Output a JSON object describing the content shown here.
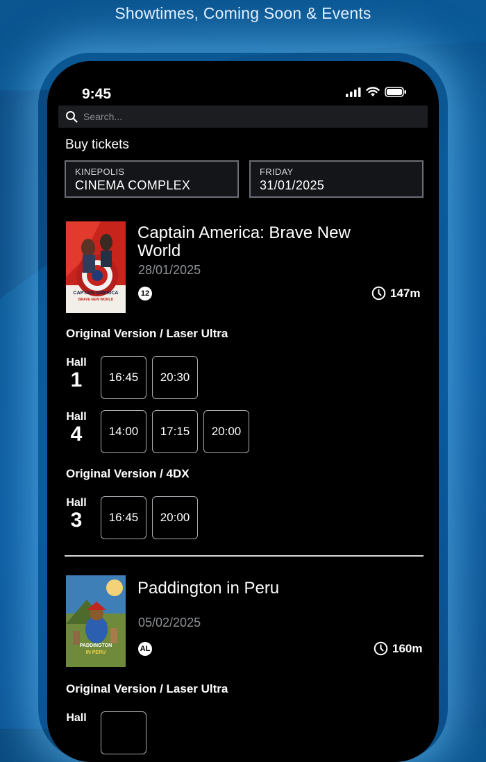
{
  "banner": {
    "title": "Showtimes, Coming Soon & Events"
  },
  "status_bar": {
    "time": "9:45"
  },
  "search": {
    "placeholder": "Search..."
  },
  "buy": {
    "title": "Buy tickets",
    "cinema_label": "KINEPOLIS",
    "cinema_value": "CINEMA COMPLEX",
    "date_label": "FRIDAY",
    "date_value": "31/01/2025"
  },
  "movies": [
    {
      "title": "Captain America: Brave New World",
      "date": "28/01/2025",
      "rating": "12",
      "duration": "147m",
      "poster_text": "CAPTAIN AMERICA",
      "poster_subtext": "BRAVE NEW WORLD",
      "versions": [
        {
          "name": "Original Version / Laser Ultra",
          "halls": [
            {
              "label": "Hall",
              "number": "1",
              "times": [
                "16:45",
                "20:30"
              ]
            },
            {
              "label": "Hall",
              "number": "4",
              "times": [
                "14:00",
                "17:15",
                "20:00"
              ]
            }
          ]
        },
        {
          "name": "Original Version / 4DX",
          "halls": [
            {
              "label": "Hall",
              "number": "3",
              "times": [
                "16:45",
                "20:00"
              ]
            }
          ]
        }
      ]
    },
    {
      "title": "Paddington in Peru",
      "date": "05/02/2025",
      "rating": "AL",
      "duration": "160m",
      "poster_text": "PADDINGTON",
      "poster_subtext": "IN PERU",
      "versions": [
        {
          "name": "Original Version / Laser Ultra",
          "halls": [
            {
              "label": "Hall",
              "number": "",
              "times": [
                ""
              ]
            }
          ]
        }
      ]
    }
  ],
  "colors": {
    "background": "#0b5a99",
    "phone": "#000000",
    "accent_glow": "#6ec8ff",
    "muted_text": "#8e9196"
  },
  "icons": [
    "search-icon",
    "signal-icon",
    "wifi-icon",
    "battery-icon",
    "clock-icon",
    "age-rating-icon"
  ]
}
